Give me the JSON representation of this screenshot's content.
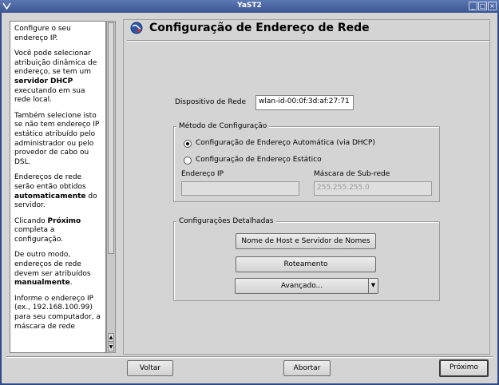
{
  "window": {
    "title": "YaST2"
  },
  "help": {
    "paragraphs": [
      [
        "Configure o seu endereço IP."
      ],
      [
        "Você pode selecionar atribuição dinâmica de endereço, se tem um ",
        "servidor DHCP",
        " executando em sua rede local."
      ],
      [
        "Também selecione isto se não tem endereço IP estático atribuído pelo administrador ou pelo provedor de cabo ou DSL."
      ],
      [
        "Endereços de rede serão então obtidos ",
        "automaticamente",
        " do servidor."
      ],
      [
        "Clicando ",
        "Próximo",
        " completa a configuração."
      ],
      [
        "De outro modo, endereços de rede devem ser atribuídos ",
        "manualmente",
        "."
      ],
      [
        "Informe o endereço IP (ex., 192.168.100.99) para seu computador, a máscara de rede"
      ]
    ]
  },
  "page": {
    "title": "Configuração de Endereço de Rede"
  },
  "device": {
    "label": "Dispositivo de Rede",
    "value": "wlan-id-00:0f:3d:af:27:71"
  },
  "method": {
    "legend": "Método de Configuração",
    "dhcp_label": "Configuração de Endereço Automática (via DHCP)",
    "static_label": "Configuração de Endereço Estático",
    "ip_label": "Endereço IP",
    "ip_value": "",
    "mask_label": "Máscara de Sub-rede",
    "mask_value": "255.255.255.0",
    "selected": "dhcp"
  },
  "details": {
    "legend": "Configurações Detalhadas",
    "host_button": "Nome de Host e Servidor de Nomes",
    "routing_button": "Roteamento",
    "advanced_button": "Avançado..."
  },
  "footer": {
    "back": "Voltar",
    "abort": "Abortar",
    "next": "Próximo"
  },
  "colors": {
    "titlebar": "#3a5592",
    "background": "#d4d4d4"
  }
}
